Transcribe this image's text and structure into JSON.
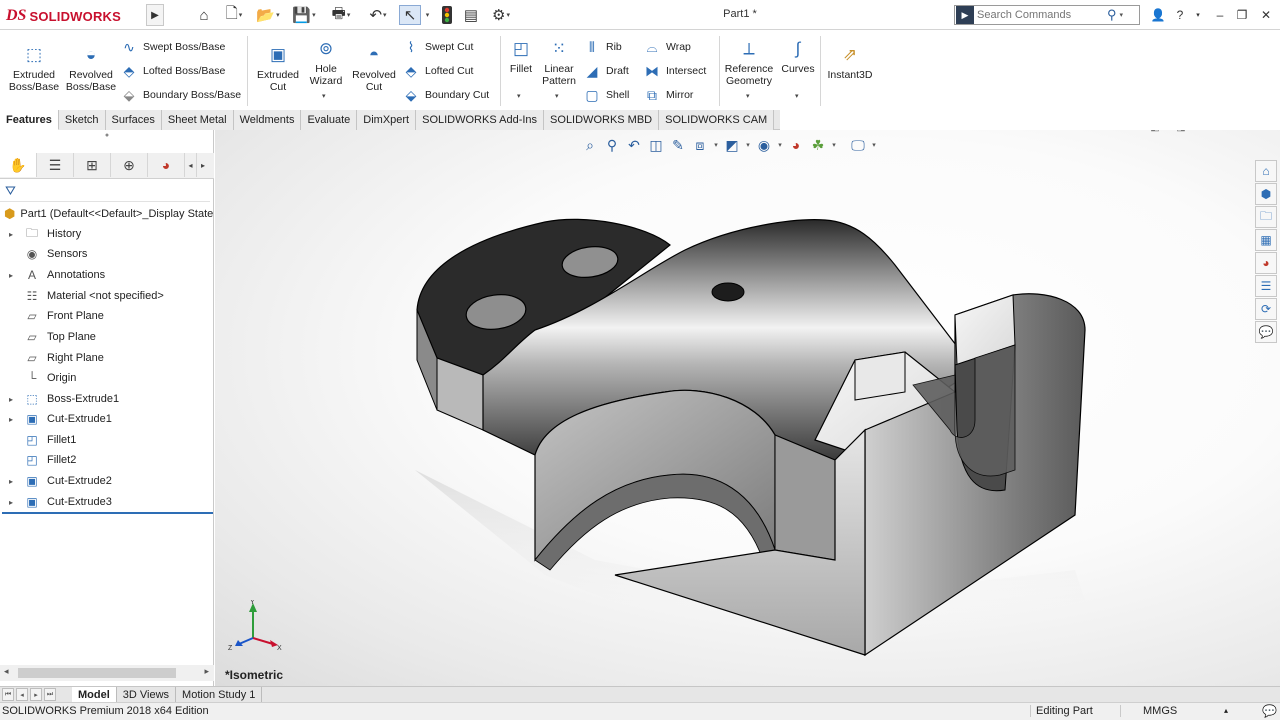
{
  "app": {
    "brand_mark": "DS",
    "brand_name": "SOLIDWORKS",
    "document_title": "Part1 *"
  },
  "search": {
    "placeholder": "Search Commands"
  },
  "ribbon": {
    "extruded_boss": "Extruded\nBoss/Base",
    "revolved_boss": "Revolved\nBoss/Base",
    "swept_boss": "Swept Boss/Base",
    "lofted_boss": "Lofted Boss/Base",
    "boundary_boss": "Boundary Boss/Base",
    "extruded_cut": "Extruded\nCut",
    "hole_wizard": "Hole\nWizard",
    "revolved_cut": "Revolved\nCut",
    "swept_cut": "Swept Cut",
    "lofted_cut": "Lofted Cut",
    "boundary_cut": "Boundary Cut",
    "fillet": "Fillet",
    "linear_pattern": "Linear\nPattern",
    "rib": "Rib",
    "draft": "Draft",
    "shell": "Shell",
    "wrap": "Wrap",
    "intersect": "Intersect",
    "mirror": "Mirror",
    "reference_geometry": "Reference\nGeometry",
    "curves": "Curves",
    "instant3d": "Instant3D"
  },
  "tabs": [
    "Features",
    "Sketch",
    "Surfaces",
    "Sheet Metal",
    "Weldments",
    "Evaluate",
    "DimXpert",
    "SOLIDWORKS Add-Ins",
    "SOLIDWORKS MBD",
    "SOLIDWORKS CAM"
  ],
  "tree": {
    "root": "Part1  (Default<<Default>_Display State",
    "items": [
      {
        "label": "History",
        "icon": "history-folder-icon",
        "expandable": true
      },
      {
        "label": "Sensors",
        "icon": "sensors-icon",
        "expandable": false
      },
      {
        "label": "Annotations",
        "icon": "annotations-icon",
        "expandable": true
      },
      {
        "label": "Material <not specified>",
        "icon": "material-icon",
        "expandable": false
      },
      {
        "label": "Front Plane",
        "icon": "plane-icon",
        "expandable": false
      },
      {
        "label": "Top Plane",
        "icon": "plane-icon",
        "expandable": false
      },
      {
        "label": "Right Plane",
        "icon": "plane-icon",
        "expandable": false
      },
      {
        "label": "Origin",
        "icon": "origin-icon",
        "expandable": false
      },
      {
        "label": "Boss-Extrude1",
        "icon": "boss-extrude-icon",
        "expandable": true
      },
      {
        "label": "Cut-Extrude1",
        "icon": "cut-extrude-icon",
        "expandable": true
      },
      {
        "label": "Fillet1",
        "icon": "fillet-icon",
        "expandable": false
      },
      {
        "label": "Fillet2",
        "icon": "fillet-icon",
        "expandable": false
      },
      {
        "label": "Cut-Extrude2",
        "icon": "cut-extrude-icon",
        "expandable": true
      },
      {
        "label": "Cut-Extrude3",
        "icon": "cut-extrude-icon",
        "expandable": true
      }
    ]
  },
  "bottom_tabs": [
    "Model",
    "3D Views",
    "Motion Study 1"
  ],
  "status": {
    "edition": "SOLIDWORKS Premium 2018 x64 Edition",
    "mode": "Editing Part",
    "units": "MMGS"
  },
  "viewport": {
    "view_name": "*Isometric",
    "triad": {
      "x": "X",
      "y": "Y",
      "z": "Z"
    }
  }
}
